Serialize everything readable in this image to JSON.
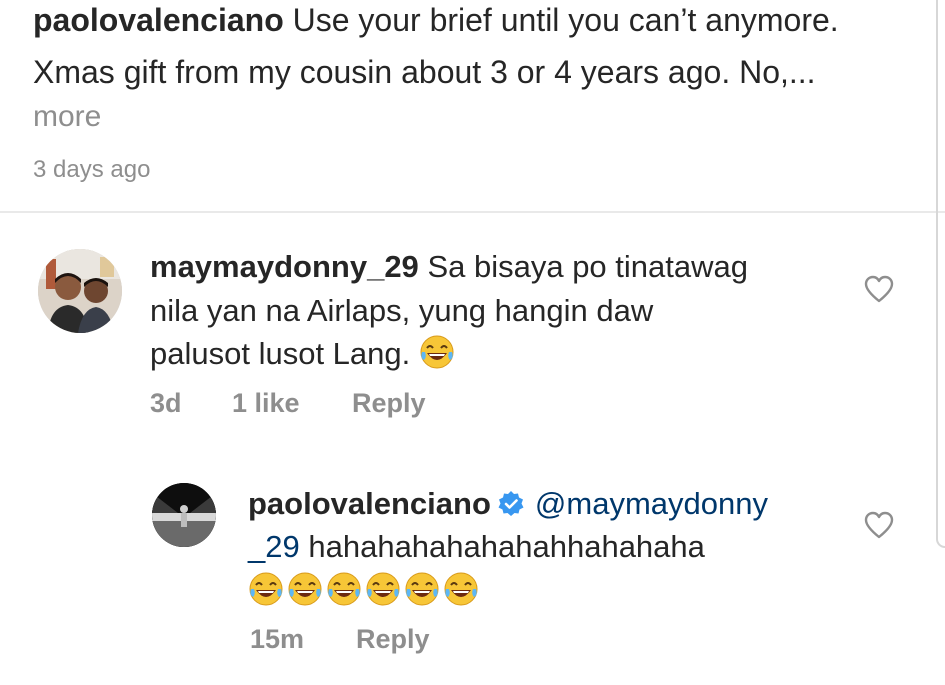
{
  "caption": {
    "username": "paolovalenciano",
    "line1_text": "Use your brief until you can’t anymore.",
    "line2_text": "Xmas gift from my cousin about 3 or 4 years ago. No,...",
    "more_label": "more",
    "time": "3 days ago"
  },
  "comment1": {
    "username": "maymaydonny_29",
    "line1_text": "Sa bisaya po tinatawag",
    "line2_text": "nila yan na Airlaps,  yung hangin daw",
    "line3_text": "palusot lusot Lang.",
    "emoji": "face-with-tears-of-joy",
    "time": "3d",
    "likes": "1 like",
    "reply_label": "Reply"
  },
  "reply1": {
    "username": "paolovalenciano",
    "verified_icon": "verified-badge-icon",
    "mention_part1": "@maymaydonny",
    "mention_part2": "_29",
    "text": "hahahahahahahahhahahaha",
    "emoji": "face-with-tears-of-joy",
    "emoji_count": 6,
    "time": "15m",
    "reply_label": "Reply"
  },
  "colors": {
    "text": "#262626",
    "secondary": "#8e8e8e",
    "mention": "#00376b",
    "verified": "#3897f0",
    "emoji": "#f7c637"
  }
}
